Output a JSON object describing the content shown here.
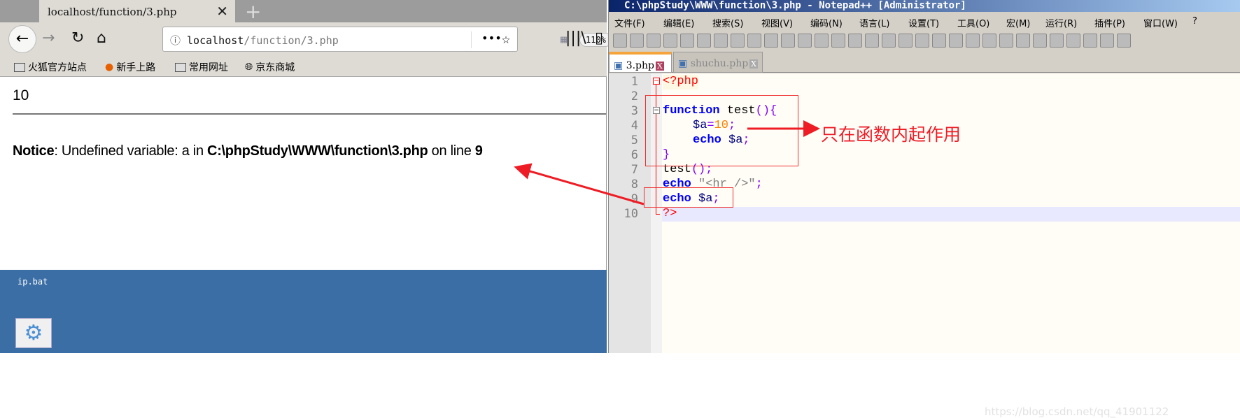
{
  "browser": {
    "tab_title": "localhost/function/3.php",
    "url_host": "localhost",
    "url_path": "/function/3.php",
    "zoom": "110%",
    "bookmarks": [
      "火狐官方站点",
      "新手上路",
      "常用网址",
      "京东商城"
    ],
    "output_value": "10",
    "notice": {
      "label": "Notice",
      "message": ": Undefined variable: a in ",
      "file": "C:\\phpStudy\\WWW\\function\\3.php",
      "on_line": " on line ",
      "line": "9"
    }
  },
  "desktop": {
    "file_label": "ip.bat"
  },
  "notepad": {
    "title": "C:\\phpStudy\\WWW\\function\\3.php - Notepad++ [Administrator]",
    "menu": [
      "文件(F)",
      "编辑(E)",
      "搜索(S)",
      "视图(V)",
      "编码(N)",
      "语言(L)",
      "设置(T)",
      "工具(O)",
      "宏(M)",
      "运行(R)",
      "插件(P)",
      "窗口(W)",
      "?"
    ],
    "tabs": [
      "3.php",
      "shuchu.php"
    ],
    "line_numbers": [
      "1",
      "2",
      "3",
      "4",
      "5",
      "6",
      "7",
      "8",
      "9",
      "10"
    ],
    "code": {
      "l1": "<?php",
      "l3_kw": "function",
      "l3_rest": " test",
      "l3_paren": "(){",
      "l4_var": "$a",
      "l4_eq": "=",
      "l4_num": "10",
      "l4_semi": ";",
      "l5_kw": "echo",
      "l5_var": " $a",
      "l5_semi": ";",
      "l6": "}",
      "l7": "test",
      "l7_p": "();",
      "l8_kw": "echo",
      "l8_str": " \"<hr />\"",
      "l8_semi": ";",
      "l9_kw": "echo",
      "l9_var": " $a",
      "l9_semi": ";",
      "l10": "?>"
    }
  },
  "annotation": "只在函数内起作用",
  "watermark": "https://blog.csdn.net/qq_41901122",
  "colors": {
    "annotation": "#ee1c24",
    "desktop": "#3a6ea5",
    "keyword": "#0000ff"
  }
}
